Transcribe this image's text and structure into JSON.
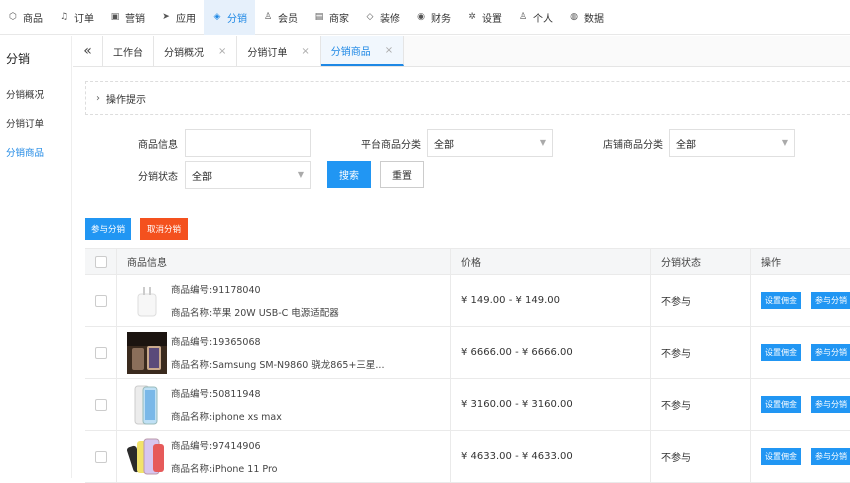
{
  "nav": [
    {
      "label": "商品",
      "icon": "tag-icon"
    },
    {
      "label": "订单",
      "icon": "bell-icon"
    },
    {
      "label": "营销",
      "icon": "megaphone-icon"
    },
    {
      "label": "应用",
      "icon": "paper-plane-icon"
    },
    {
      "label": "分销",
      "icon": "layers-icon",
      "active": true
    },
    {
      "label": "会员",
      "icon": "user-icon"
    },
    {
      "label": "商家",
      "icon": "store-icon"
    },
    {
      "label": "装修",
      "icon": "brush-icon"
    },
    {
      "label": "财务",
      "icon": "money-icon"
    },
    {
      "label": "设置",
      "icon": "gear-icon"
    },
    {
      "label": "个人",
      "icon": "person-icon"
    },
    {
      "label": "数据",
      "icon": "globe-icon"
    }
  ],
  "sidebar": {
    "title": "分销",
    "items": [
      {
        "label": "分销概况"
      },
      {
        "label": "分销订单"
      },
      {
        "label": "分销商品",
        "active": true
      }
    ]
  },
  "tabs": [
    {
      "label": "工作台"
    },
    {
      "label": "分销概况",
      "close": "×"
    },
    {
      "label": "分销订单",
      "close": "×"
    },
    {
      "label": "分销商品",
      "close": "×",
      "active": true
    }
  ],
  "tips": {
    "label": "操作提示"
  },
  "filters": {
    "product_info_label": "商品信息",
    "product_info_value": "",
    "platform_category_label": "平台商品分类",
    "platform_category_value": "全部",
    "shop_category_label": "店铺商品分类",
    "shop_category_value": "全部",
    "status_label": "分销状态",
    "status_value": "全部",
    "search_button": "搜索",
    "reset_button": "重置"
  },
  "actions": {
    "join": "参与分销",
    "cancel": "取消分销"
  },
  "table": {
    "headers": {
      "info": "商品信息",
      "price": "价格",
      "status": "分销状态",
      "op": "操作"
    },
    "rows": [
      {
        "code": "商品编号:91178040",
        "name": "商品名称:苹果 20W USB-C 电源适配器",
        "price": "¥ 149.00 - ¥ 149.00",
        "status": "不参与",
        "op1": "设置佣金",
        "op2": "参与分销",
        "thumb": "adapter"
      },
      {
        "code": "商品编号:19365068",
        "name": "商品名称:Samsung SM-N9860 骁龙865+三星...",
        "price": "¥ 6666.00 - ¥ 6666.00",
        "status": "不参与",
        "op1": "设置佣金",
        "op2": "参与分销",
        "thumb": "samsung"
      },
      {
        "code": "商品编号:50811948",
        "name": "商品名称:iphone xs max",
        "price": "¥ 3160.00 - ¥ 3160.00",
        "status": "不参与",
        "op1": "设置佣金",
        "op2": "参与分销",
        "thumb": "iphonexs"
      },
      {
        "code": "商品编号:97414906",
        "name": "商品名称:iPhone 11 Pro",
        "price": "¥ 4633.00 - ¥ 4633.00",
        "status": "不参与",
        "op1": "设置佣金",
        "op2": "参与分销",
        "thumb": "iphone11"
      }
    ]
  }
}
